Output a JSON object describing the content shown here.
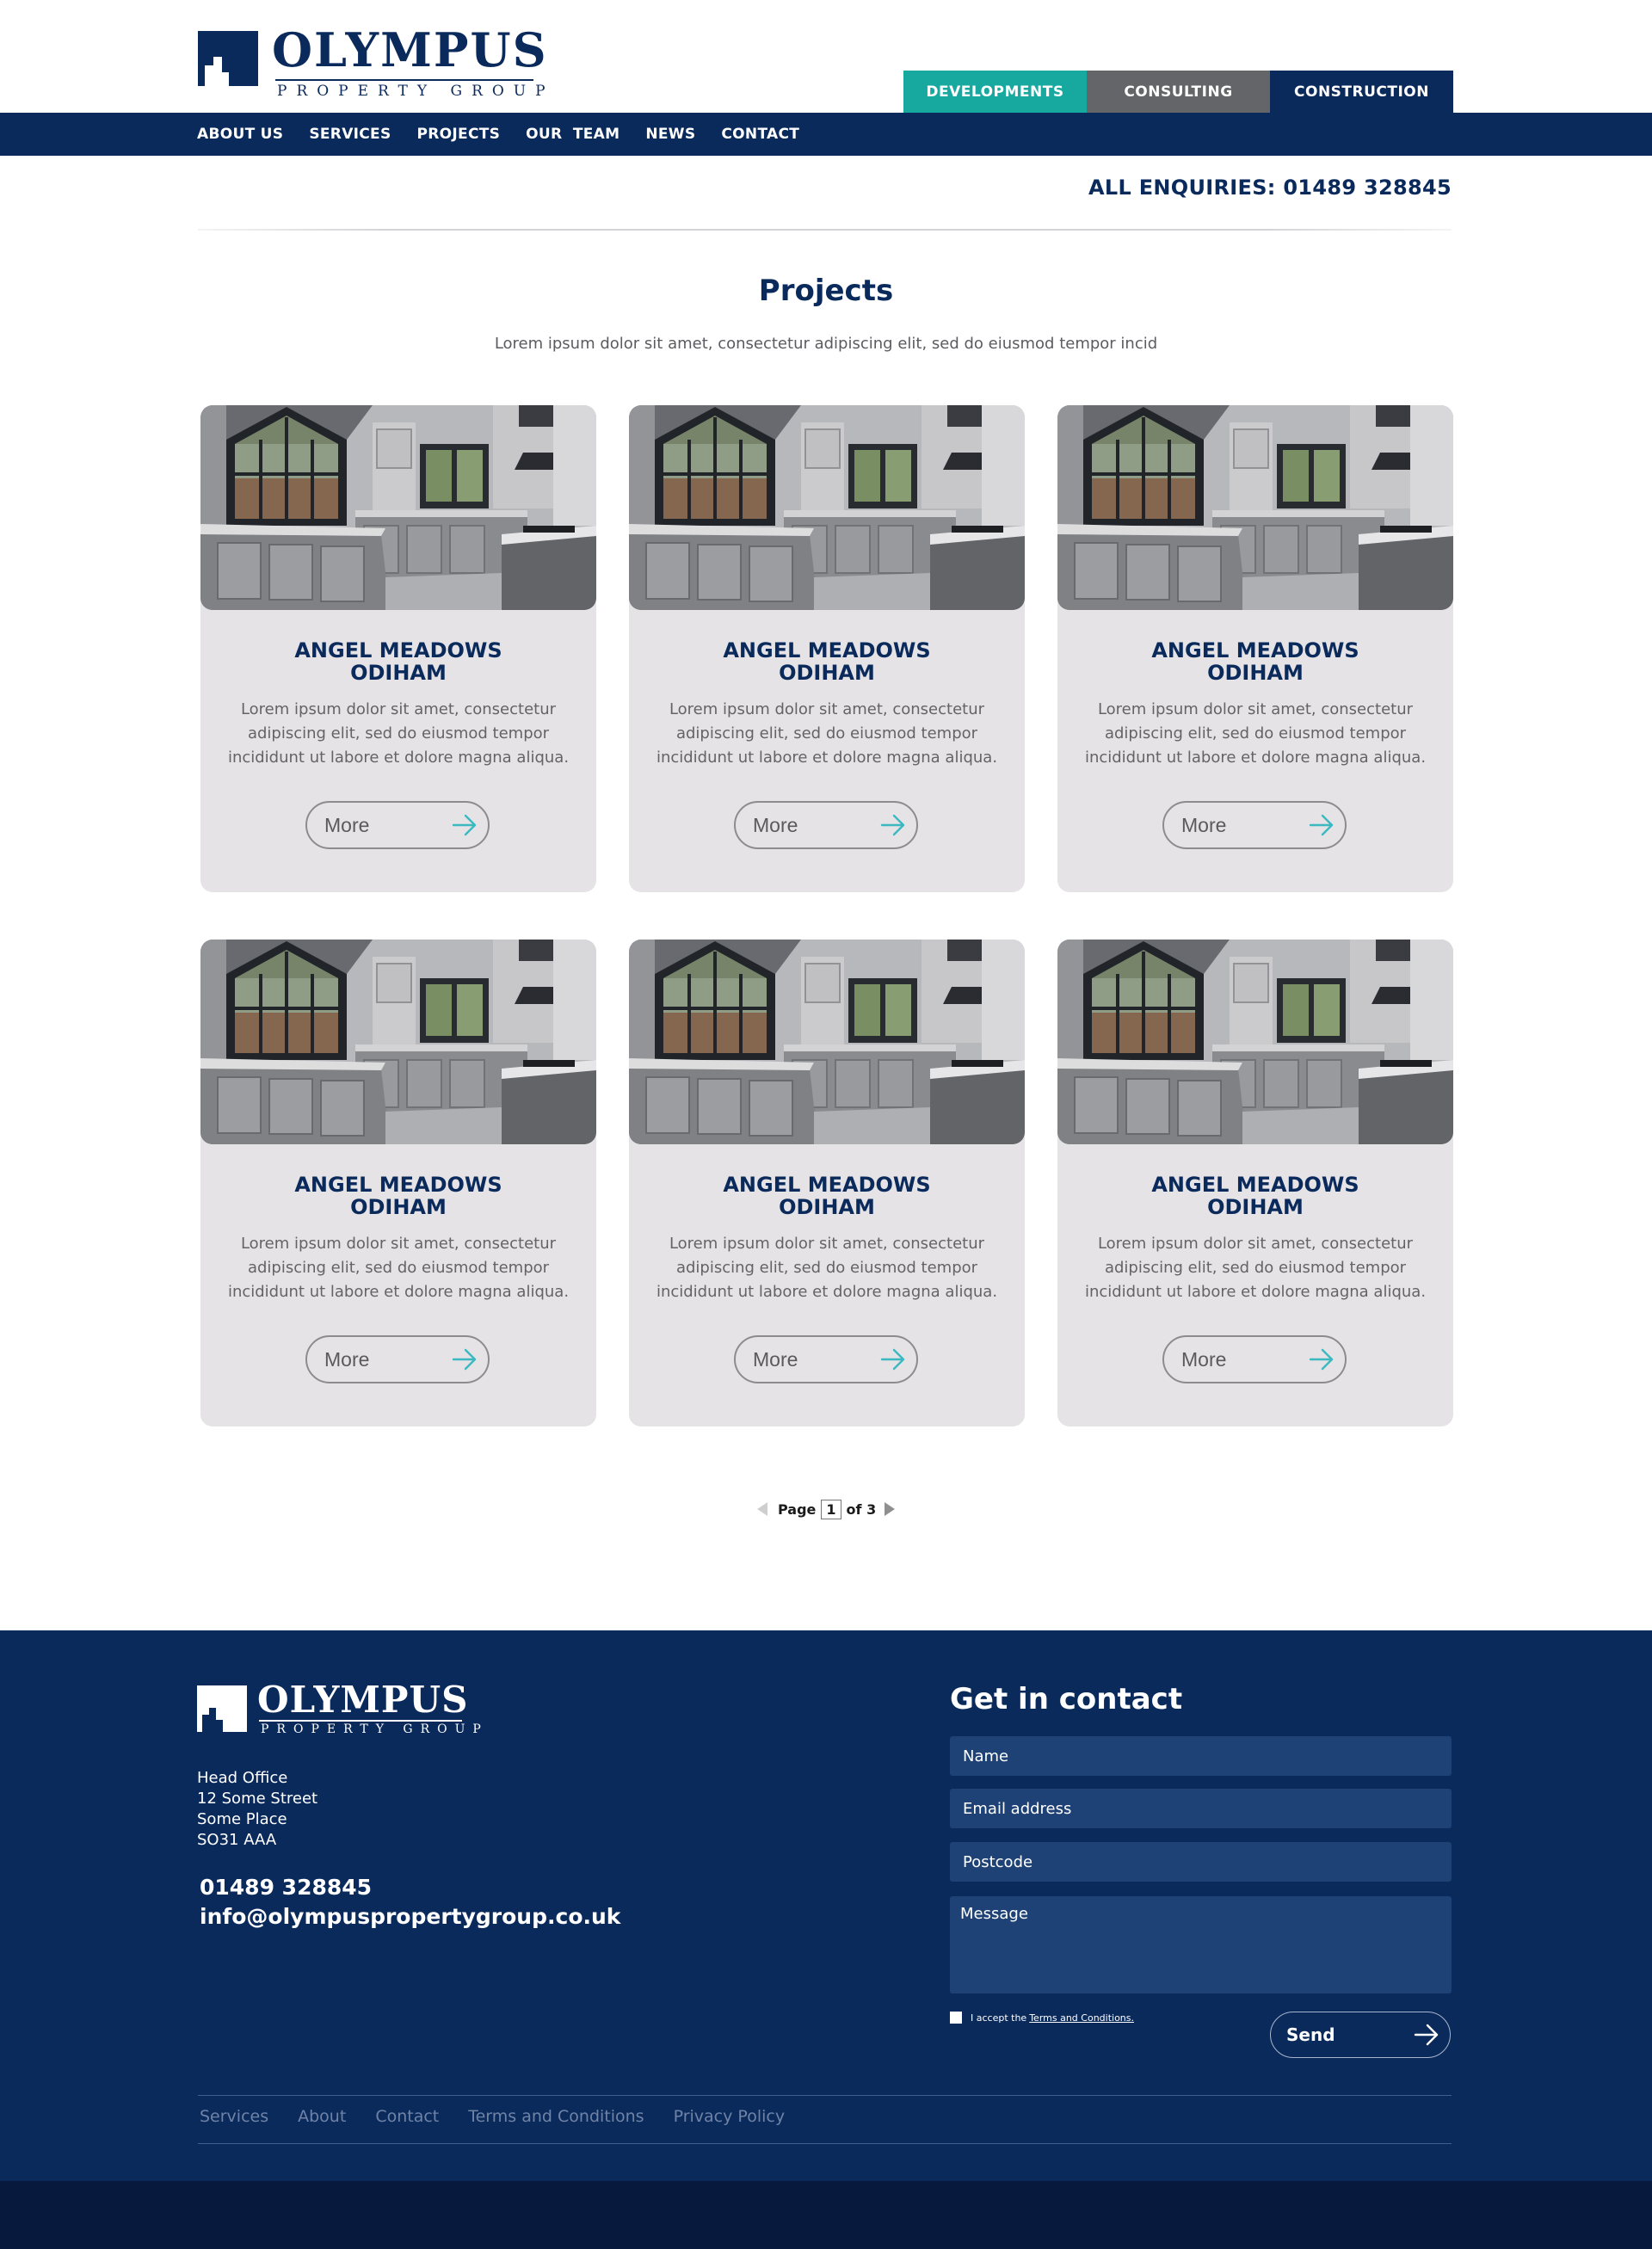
{
  "brand": {
    "name": "OLYMPUS",
    "tagline": "PROPERTY GROUP"
  },
  "division_tabs": [
    {
      "label": "DEVELOPMENTS",
      "color": "#17a9a0"
    },
    {
      "label": "CONSULTING",
      "color": "#636569"
    },
    {
      "label": "CONSTRUCTION",
      "color": "#0b2a5c"
    }
  ],
  "nav": [
    "ABOUT US",
    "SERVICES",
    "PROJECTS",
    "OUR  TEAM",
    "NEWS",
    "CONTACT"
  ],
  "enquiries": "ALL ENQUIRIES: 01489 328845",
  "main": {
    "title": "Projects",
    "intro": "Lorem ipsum dolor sit amet, consectetur adipiscing elit, sed do eiusmod tempor incid"
  },
  "projects": [
    {
      "title_line1": "ANGEL MEADOWS",
      "title_line2": "ODIHAM",
      "description": "Lorem ipsum dolor sit amet, consectetur adipiscing elit, sed do eiusmod tempor incididunt ut labore et dolore magna aliqua.",
      "button": "More",
      "image": "kitchen-photo"
    },
    {
      "title_line1": "ANGEL MEADOWS",
      "title_line2": "ODIHAM",
      "description": "Lorem ipsum dolor sit amet, consectetur adipiscing elit, sed do eiusmod tempor incididunt ut labore et dolore magna aliqua.",
      "button": "More",
      "image": "kitchen-photo"
    },
    {
      "title_line1": "ANGEL MEADOWS",
      "title_line2": "ODIHAM",
      "description": "Lorem ipsum dolor sit amet, consectetur adipiscing elit, sed do eiusmod tempor incididunt ut labore et dolore magna aliqua.",
      "button": "More",
      "image": "kitchen-photo"
    },
    {
      "title_line1": "ANGEL MEADOWS",
      "title_line2": "ODIHAM",
      "description": "Lorem ipsum dolor sit amet, consectetur adipiscing elit, sed do eiusmod tempor incididunt ut labore et dolore magna aliqua.",
      "button": "More",
      "image": "kitchen-photo"
    },
    {
      "title_line1": "ANGEL MEADOWS",
      "title_line2": "ODIHAM",
      "description": "Lorem ipsum dolor sit amet, consectetur adipiscing elit, sed do eiusmod tempor incididunt ut labore et dolore magna aliqua.",
      "button": "More",
      "image": "kitchen-photo"
    },
    {
      "title_line1": "ANGEL MEADOWS",
      "title_line2": "ODIHAM",
      "description": "Lorem ipsum dolor sit amet, consectetur adipiscing elit, sed do eiusmod tempor incididunt ut labore et dolore magna aliqua.",
      "button": "More",
      "image": "kitchen-photo"
    }
  ],
  "pagination": {
    "label": "Page",
    "current": "1",
    "total_label": "of 3"
  },
  "footer": {
    "address": [
      "Head Office",
      "12 Some Street",
      "Some Place",
      "SO31 AAA"
    ],
    "phone": "01489 328845",
    "email": "info@olympuspropertygroup.co.uk",
    "contact_title": "Get in contact",
    "form": {
      "name_placeholder": "Name",
      "email_placeholder": "Email address",
      "postcode_placeholder": "Postcode",
      "message_placeholder": "Message",
      "terms_prefix": "I accept the",
      "terms_link": "Terms and Conditions.",
      "send_label": "Send"
    },
    "links": [
      "Services",
      "About",
      "Contact",
      "Terms and Conditions",
      "Privacy Policy"
    ]
  },
  "colors": {
    "navy": "#0b2a5c",
    "teal": "#17a9a0",
    "grey": "#636569",
    "card_bg": "#e5e3e5",
    "footer_bottom": "#071a3d"
  }
}
